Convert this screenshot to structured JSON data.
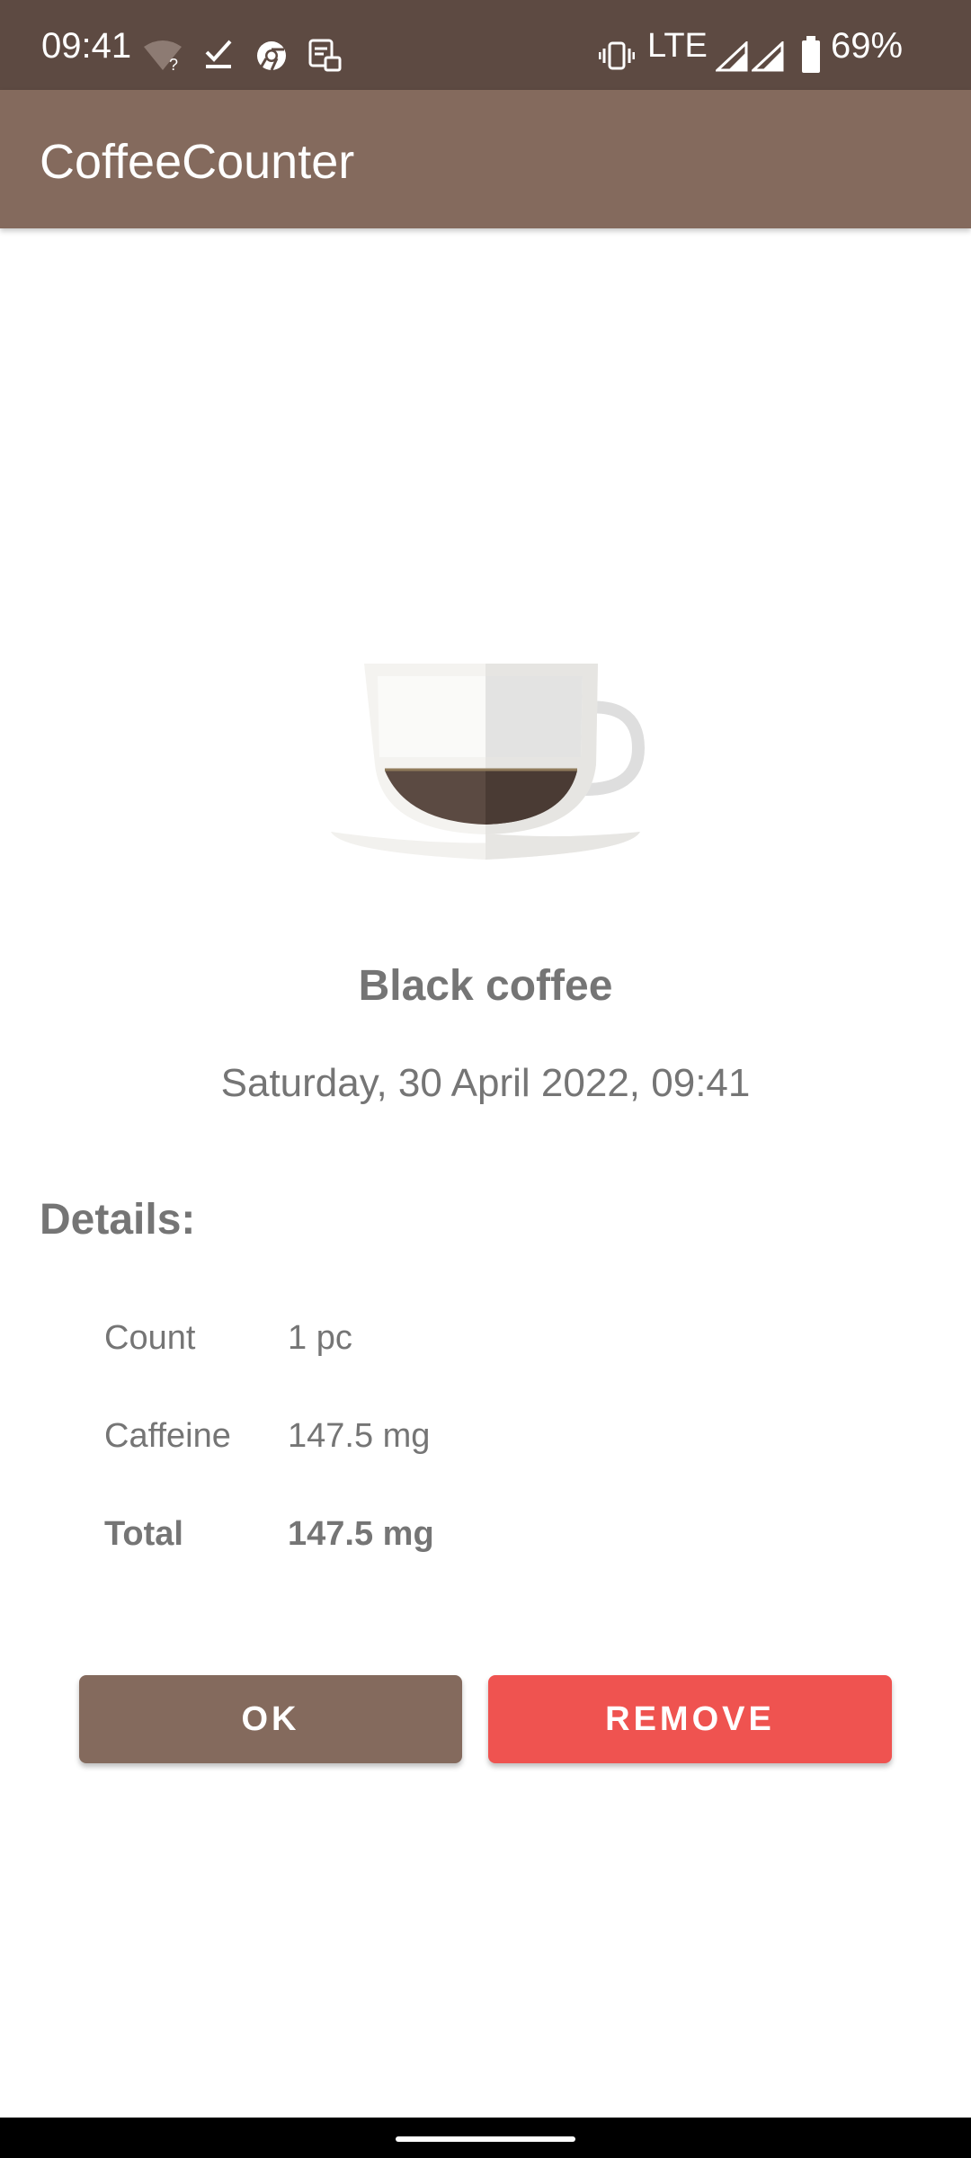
{
  "status_bar": {
    "time": "09:41",
    "network": "LTE",
    "battery": "69%",
    "icons": [
      "wifi-unknown-icon",
      "check-icon",
      "chrome-icon",
      "notification-app-icon",
      "vibrate-icon",
      "signal-icon",
      "battery-icon"
    ]
  },
  "app_bar": {
    "title": "CoffeeCounter"
  },
  "drink": {
    "icon": "coffee-cup-icon",
    "name": "Black coffee",
    "date": "Saturday, 30 April 2022, 09:41"
  },
  "details": {
    "heading": "Details:",
    "rows": [
      {
        "label": "Count",
        "value": "1 pc"
      },
      {
        "label": "Caffeine",
        "value": "147.5 mg"
      },
      {
        "label": "Total",
        "value": "147.5 mg"
      }
    ]
  },
  "actions": {
    "ok_label": "OK",
    "remove_label": "REMOVE"
  },
  "colors": {
    "status_bar": "#5d4a42",
    "app_bar": "#846a5d",
    "ok_button": "#846a5d",
    "remove_button": "#ef5350",
    "text": "#757575"
  }
}
